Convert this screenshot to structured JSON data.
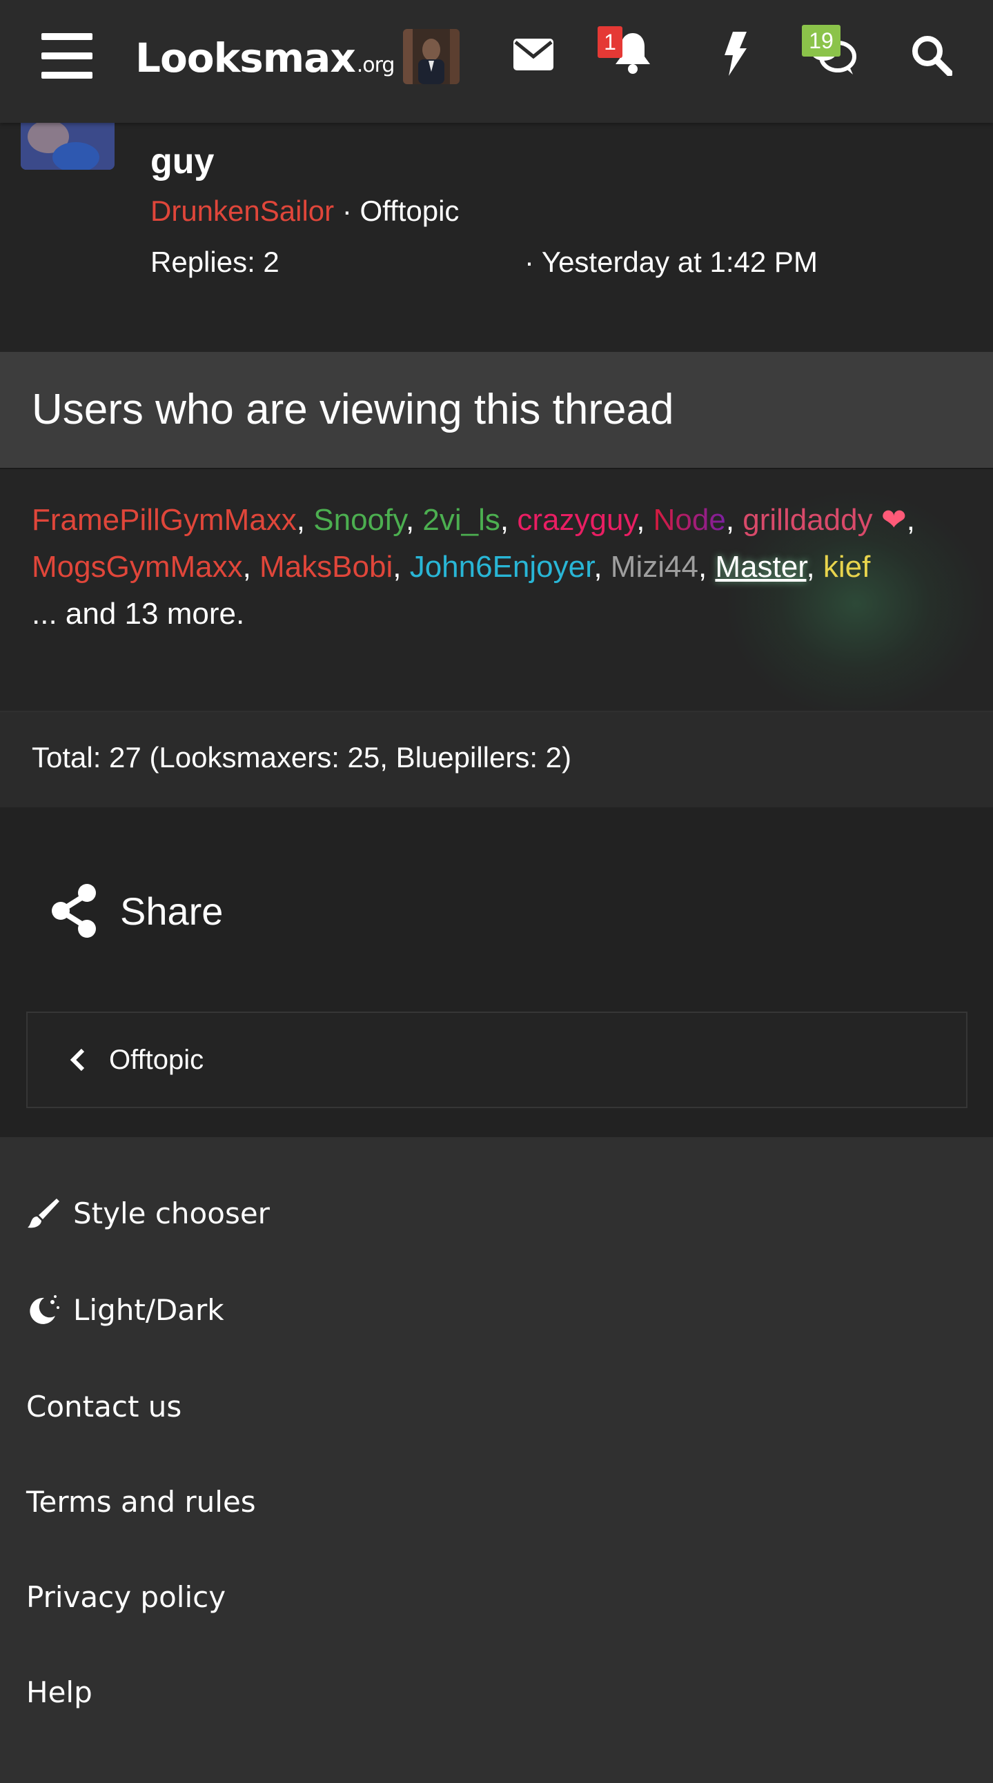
{
  "header": {
    "logo_main": "Looksmax",
    "logo_tld": ".org",
    "notifications_count": "1",
    "conversations_count": "19",
    "colors": {
      "bar": "#2b2b2b",
      "alert_badge": "#e53935",
      "conversation_badge": "#8bc34a"
    },
    "icons": [
      "menu-icon",
      "avatar",
      "envelope-icon",
      "bell-icon",
      "bolt-icon",
      "chat-bubbles-icon",
      "search-icon"
    ]
  },
  "thread": {
    "title_last_line": "guy",
    "author": "DrunkenSailor",
    "forum": "Offtopic",
    "replies": "Replies: 2",
    "date": "Yesterday at 1:42 PM"
  },
  "viewing": {
    "heading": "Users who are viewing this thread",
    "users": [
      {
        "name": "FramePillGymMaxx",
        "color": "#e0463a"
      },
      {
        "name": "Snoofy",
        "color": "#4caf50"
      },
      {
        "name": "2vi_ls",
        "color": "#4caf50"
      },
      {
        "name": "crazyguy",
        "color": "#e91e63"
      },
      {
        "name": "Node",
        "color": "#c2185b"
      },
      {
        "name": "grilldaddy",
        "color": "#d94a6a"
      },
      {
        "name": "MogsGymMaxx",
        "color": "#e0463a"
      },
      {
        "name": "MaksBobi",
        "color": "#e0463a"
      },
      {
        "name": "John6Enjoyer",
        "color": "#29b6d6"
      },
      {
        "name": "Mizi44",
        "color": "#9e9e9e"
      },
      {
        "name": "Master",
        "color": "#ffffff"
      },
      {
        "name": "kief",
        "color": "#e8d44d"
      }
    ],
    "more": "... and 13 more.",
    "total": "Total: 27 (Looksmaxers: 25, Bluepillers: 2)"
  },
  "actions": {
    "share_label": "Share",
    "back_label": "Offtopic"
  },
  "footer": {
    "style_chooser": "Style chooser",
    "light_dark": "Light/Dark",
    "contact": "Contact us",
    "terms": "Terms and rules",
    "privacy": "Privacy policy",
    "help": "Help"
  }
}
